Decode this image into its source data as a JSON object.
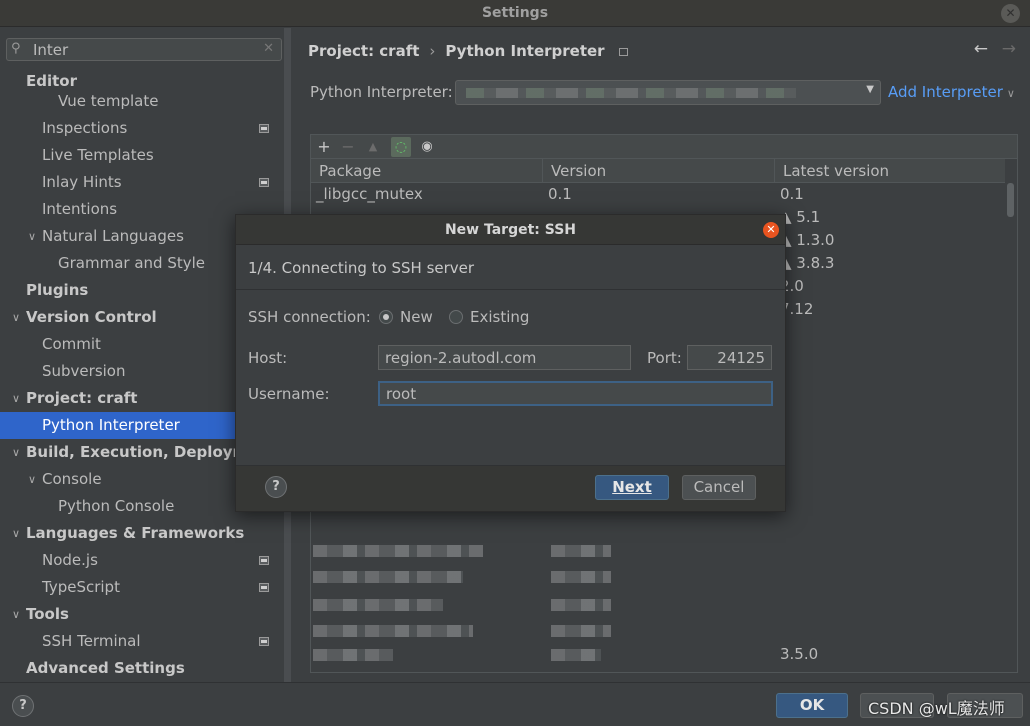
{
  "window": {
    "title": "Settings"
  },
  "search": {
    "value": "Inter"
  },
  "sidebar": {
    "items": [
      {
        "label": "Editor"
      },
      {
        "label": "Vue template"
      },
      {
        "label": "Inspections"
      },
      {
        "label": "Live Templates"
      },
      {
        "label": "Inlay Hints"
      },
      {
        "label": "Intentions"
      },
      {
        "label": "Natural Languages"
      },
      {
        "label": "Grammar and Style"
      },
      {
        "label": "Plugins"
      },
      {
        "label": "Version Control"
      },
      {
        "label": "Commit"
      },
      {
        "label": "Subversion"
      },
      {
        "label": "Project: craft"
      },
      {
        "label": "Python Interpreter"
      },
      {
        "label": "Build, Execution, Deployme"
      },
      {
        "label": "Console"
      },
      {
        "label": "Python Console"
      },
      {
        "label": "Languages & Frameworks"
      },
      {
        "label": "Node.js"
      },
      {
        "label": "TypeScript"
      },
      {
        "label": "Tools"
      },
      {
        "label": "SSH Terminal"
      },
      {
        "label": "Advanced Settings"
      }
    ]
  },
  "main": {
    "breadcrumb": {
      "parent": "Project: craft",
      "separator": "›",
      "current": "Python Interpreter"
    },
    "interpreter_label": "Python Interpreter:",
    "add_interpreter_label": "Add Interpreter",
    "packages": {
      "columns": [
        "Package",
        "Version",
        "Latest version"
      ],
      "rows": [
        {
          "package": "_libgcc_mutex",
          "version": "0.1",
          "latest": "0.1"
        },
        {
          "package": "",
          "version": "",
          "latest": "▲ 5.1"
        },
        {
          "package": "",
          "version": "",
          "latest": "▲ 1.3.0"
        },
        {
          "package": "",
          "version": "",
          "latest": "▲ 3.8.3"
        },
        {
          "package": "",
          "version": "",
          "latest": "2.0"
        },
        {
          "package": "",
          "version": "",
          "latest": "7.12"
        },
        {
          "package": "",
          "version": "",
          "latest": "3.5.0"
        }
      ]
    }
  },
  "dialog": {
    "title": "New Target: SSH",
    "step": "1/4. Connecting to SSH server",
    "ssh_connection_label": "SSH connection:",
    "option_new": "New",
    "option_existing": "Existing",
    "host_label": "Host:",
    "host_value": "region-2.autodl.com",
    "port_label": "Port:",
    "port_value": "24125",
    "username_label": "Username:",
    "username_value": "root",
    "help_label": "?",
    "next_label": "Next",
    "cancel_label": "Cancel"
  },
  "footer": {
    "help_label": "?",
    "ok_label": "OK",
    "watermark": "CSDN @wL魔法师"
  },
  "colors": {
    "accent": "#2f65ca",
    "link": "#589df6",
    "primary_button": "#365880",
    "close_button": "#e95420"
  }
}
